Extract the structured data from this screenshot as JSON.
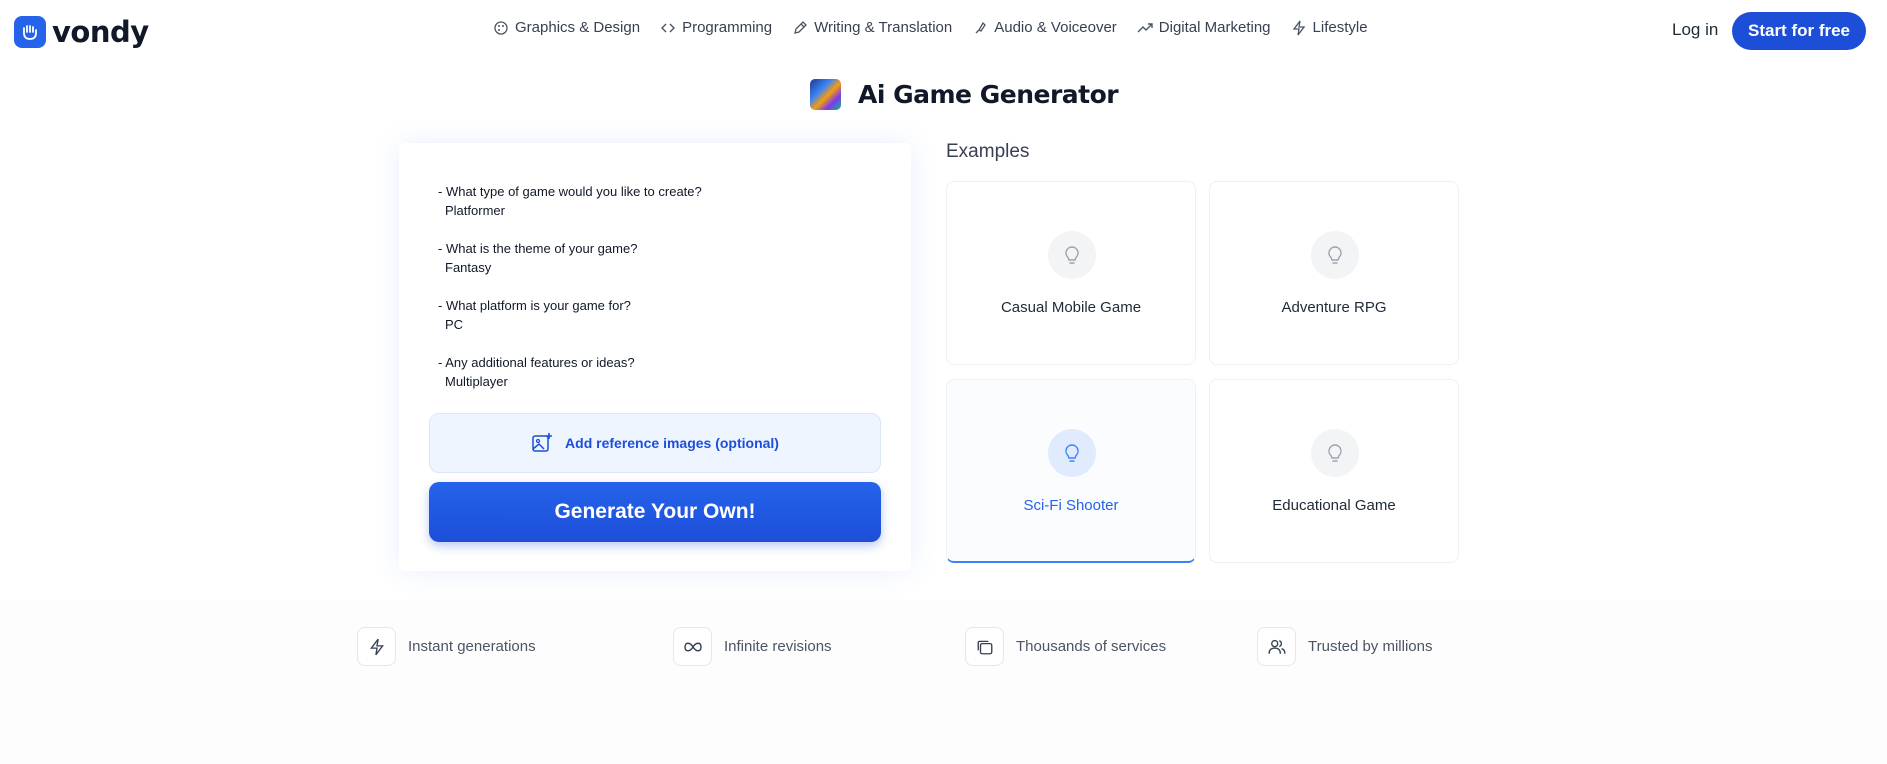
{
  "header": {
    "logo_text": "vondy",
    "nav": [
      {
        "label": "Graphics & Design",
        "icon": "palette-icon"
      },
      {
        "label": "Programming",
        "icon": "code-icon"
      },
      {
        "label": "Writing & Translation",
        "icon": "pen-icon"
      },
      {
        "label": "Audio & Voiceover",
        "icon": "mic-icon"
      },
      {
        "label": "Digital Marketing",
        "icon": "trend-icon"
      },
      {
        "label": "Lifestyle",
        "icon": "bolt-icon"
      }
    ],
    "login_label": "Log in",
    "start_label": "Start for free"
  },
  "page": {
    "title": "Ai Game Generator"
  },
  "form": {
    "items": [
      {
        "q": "- What type of game would you like to create?",
        "a": "Platformer"
      },
      {
        "q": "- What is the theme of your game?",
        "a": "Fantasy"
      },
      {
        "q": "- What platform is your game for?",
        "a": "PC"
      },
      {
        "q": "- Any additional features or ideas?",
        "a": "Multiplayer"
      }
    ],
    "ref_label": "Add reference images (optional)",
    "generate_label": "Generate Your Own!"
  },
  "examples": {
    "title": "Examples",
    "items": [
      {
        "label": "Casual Mobile Game",
        "active": false
      },
      {
        "label": "Adventure RPG",
        "active": false
      },
      {
        "label": "Sci-Fi Shooter",
        "active": true
      },
      {
        "label": "Educational Game",
        "active": false
      }
    ]
  },
  "features": [
    {
      "label": "Instant generations",
      "icon": "bolt-icon"
    },
    {
      "label": "Infinite revisions",
      "icon": "infinity-icon"
    },
    {
      "label": "Thousands of services",
      "icon": "stack-icon"
    },
    {
      "label": "Trusted by millions",
      "icon": "users-icon"
    }
  ],
  "colors": {
    "brand": "#1d4ed8",
    "accent": "#2563eb",
    "ref_bg": "#eff5ff"
  }
}
